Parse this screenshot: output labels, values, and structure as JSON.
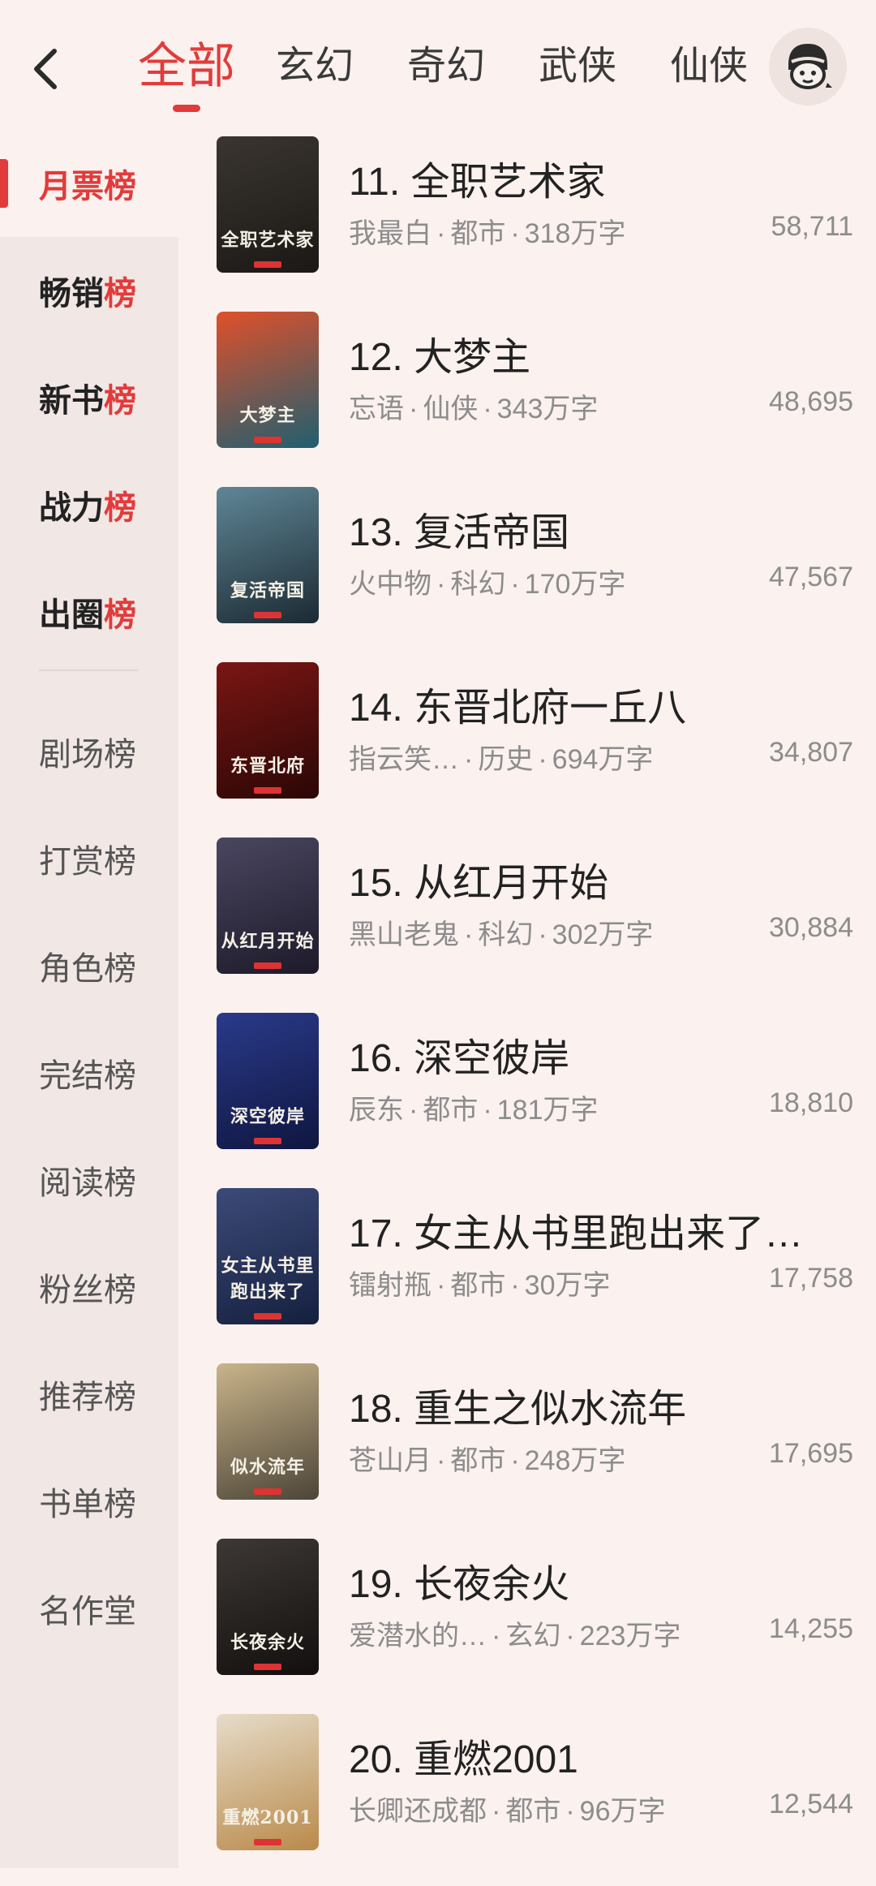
{
  "header": {
    "tabs": [
      "全部",
      "玄幻",
      "奇幻",
      "武侠",
      "仙侠"
    ],
    "active_tab": 0
  },
  "sidebar": {
    "items": [
      {
        "label": "月票榜",
        "style": "active"
      },
      {
        "label": "畅销榜",
        "style": "bold"
      },
      {
        "label": "新书榜",
        "style": "bold"
      },
      {
        "label": "战力榜",
        "style": "bold"
      },
      {
        "label": "出圈榜",
        "style": "bold"
      },
      {
        "label": "剧场榜",
        "style": "normal"
      },
      {
        "label": "打赏榜",
        "style": "normal"
      },
      {
        "label": "角色榜",
        "style": "normal"
      },
      {
        "label": "完结榜",
        "style": "normal"
      },
      {
        "label": "阅读榜",
        "style": "normal"
      },
      {
        "label": "粉丝榜",
        "style": "normal"
      },
      {
        "label": "推荐榜",
        "style": "normal"
      },
      {
        "label": "书单榜",
        "style": "normal"
      },
      {
        "label": "名作堂",
        "style": "normal"
      }
    ]
  },
  "books": [
    {
      "title": "11. 全职艺术家",
      "author": "我最白",
      "genre": "都市",
      "words": "318万字",
      "votes": "58,711",
      "cover_text": "全职艺术家",
      "colors": [
        "#3a3530",
        "#1b1815"
      ]
    },
    {
      "title": "12. 大梦主",
      "author": "忘语",
      "genre": "仙侠",
      "words": "343万字",
      "votes": "48,695",
      "cover_text": "大梦主",
      "colors": [
        "#e0502a",
        "#1f5f70"
      ]
    },
    {
      "title": "13. 复活帝国",
      "author": "火中物",
      "genre": "科幻",
      "words": "170万字",
      "votes": "47,567",
      "cover_text": "复活帝国",
      "colors": [
        "#5f8696",
        "#1c2a33"
      ]
    },
    {
      "title": "14. 东晋北府一丘八",
      "author": "指云笑…",
      "genre": "历史",
      "words": "694万字",
      "votes": "34,807",
      "cover_text": "东晋北府",
      "colors": [
        "#7a1614",
        "#2a0705"
      ]
    },
    {
      "title": "15. 从红月开始",
      "author": "黑山老鬼",
      "genre": "科幻",
      "words": "302万字",
      "votes": "30,884",
      "cover_text": "从红月开始",
      "colors": [
        "#4a4660",
        "#1d1a2a"
      ]
    },
    {
      "title": "16. 深空彼岸",
      "author": "辰东",
      "genre": "都市",
      "words": "181万字",
      "votes": "18,810",
      "cover_text": "深空彼岸",
      "colors": [
        "#2a3a8a",
        "#0f1640"
      ]
    },
    {
      "title": "17. 女主从书里跑出来了…",
      "author": "镭射瓶",
      "genre": "都市",
      "words": "30万字",
      "votes": "17,758",
      "cover_text": "女主从书里跑出来了",
      "colors": [
        "#3c4a78",
        "#15203f"
      ]
    },
    {
      "title": "18. 重生之似水流年",
      "author": "苍山月",
      "genre": "都市",
      "words": "248万字",
      "votes": "17,695",
      "cover_text": "似水流年",
      "colors": [
        "#c9b48a",
        "#4d4538"
      ]
    },
    {
      "title": "19. 长夜余火",
      "author": "爱潜水的…",
      "genre": "玄幻",
      "words": "223万字",
      "votes": "14,255",
      "cover_text": "长夜余火",
      "colors": [
        "#3d3835",
        "#120f0e"
      ]
    },
    {
      "title": "20. 重燃2001",
      "author": "长卿还成都",
      "genre": "都市",
      "words": "96万字",
      "votes": "12,544",
      "cover_text": "重燃2001",
      "colors": [
        "#e6dcc9",
        "#b98a4a"
      ]
    }
  ]
}
